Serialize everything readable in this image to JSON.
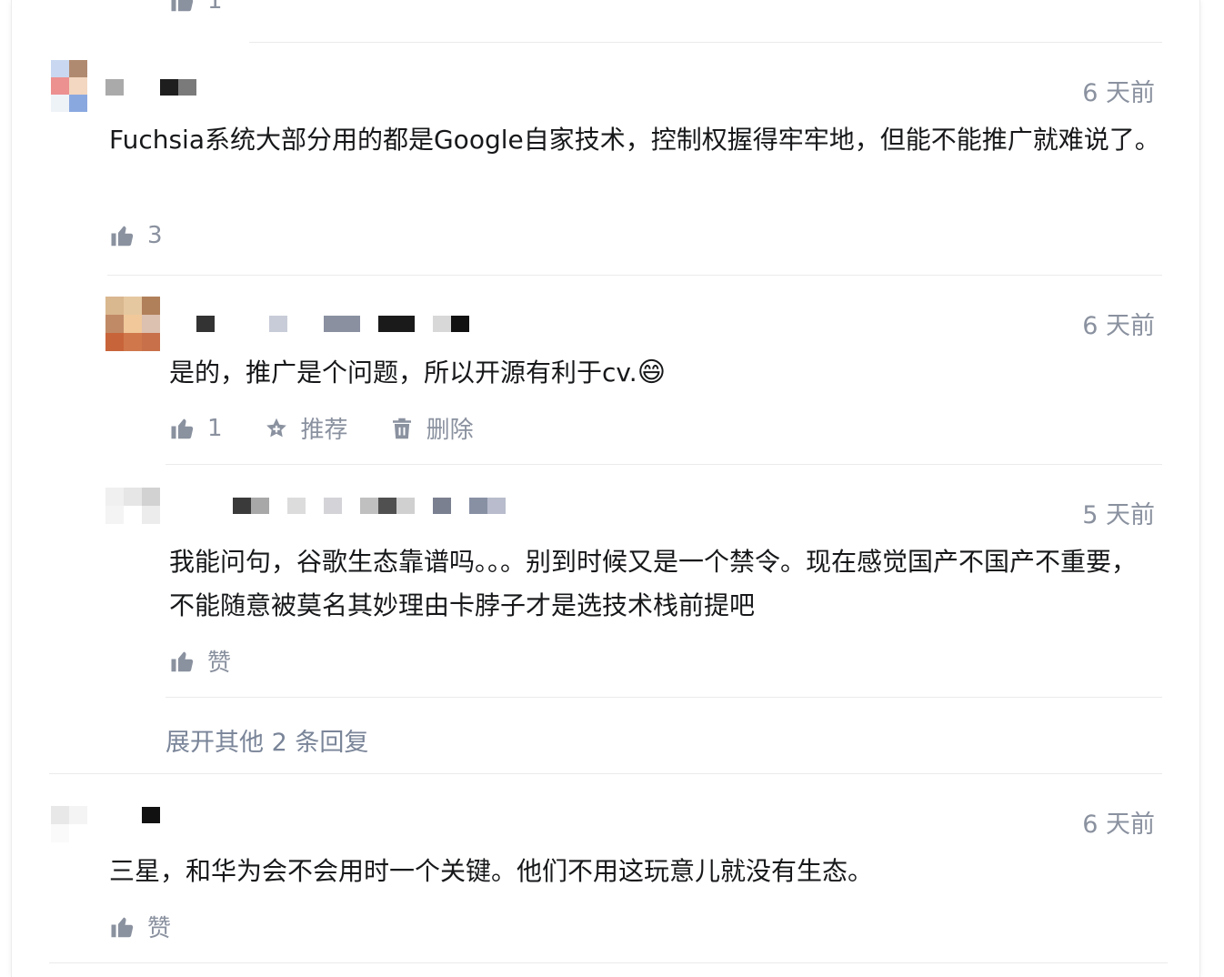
{
  "top_comment_like_count": "1",
  "comments": [
    {
      "time": "6 天前",
      "text": "Fuchsia系统大部分用的都是Google自家技术，控制权握得牢牢地，但能不能推广就难说了。",
      "like_count": "3"
    },
    {
      "time": "6 天前",
      "text": "是的，推广是个问题，所以开源有利于cv.",
      "emoji": "😄",
      "like_count": "1",
      "recommend_label": "推荐",
      "delete_label": "删除"
    },
    {
      "time": "5 天前",
      "text": "我能问句，谷歌生态靠谱吗。。。别到时候又是一个禁令。现在感觉国产不国产不重要，不能随意被莫名其妙理由卡脖子才是选技术栈前提吧",
      "like_label": "赞"
    },
    {
      "time": "6 天前",
      "text": "三星，和华为会不会用时一个关键。他们不用这玩意儿就没有生态。",
      "like_label": "赞"
    }
  ],
  "expand_replies_label": "展开其他 2 条回复",
  "icons": {
    "like": "thumbs-up-icon",
    "recommend": "star-plus-icon",
    "delete": "trash-icon"
  },
  "colors": {
    "text": "#17181a",
    "meta": "#8a919f",
    "link": "#7a8599",
    "divider": "#ebebeb"
  }
}
